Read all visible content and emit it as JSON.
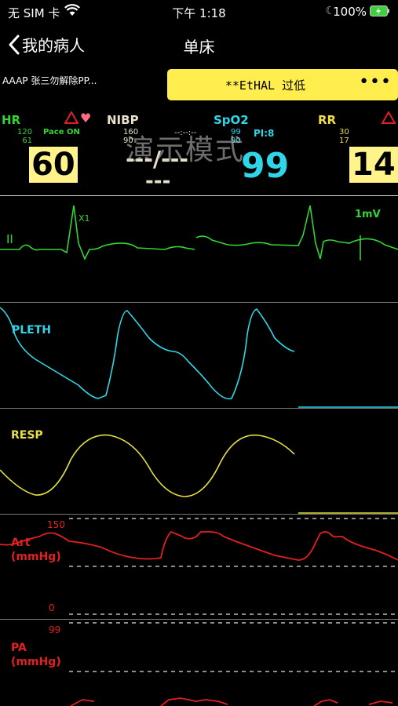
{
  "status_bar": {
    "carrier": "无 SIM 卡",
    "time": "下午 1:18",
    "battery": "100%"
  },
  "nav": {
    "back_label": "我的病人",
    "title": "单床"
  },
  "patient": {
    "info": "AAAP   张三勿解除PP..."
  },
  "alarm": {
    "message": "**EtHAL 过低",
    "more": "•••"
  },
  "watermark": "演示模式",
  "vitals": {
    "hr": {
      "label": "HR",
      "limit_high": "120",
      "limit_low": "61",
      "pace": "Pace ON",
      "value": "60",
      "color": "#35d435"
    },
    "nibp": {
      "label": "NIBP",
      "limit_high": "160",
      "limit_low": "90",
      "time": "--:--:--",
      "value_main": "---/---",
      "value_mean": "---",
      "color": "#e8e0c8"
    },
    "spo2": {
      "label": "SpO2",
      "limit_high": "99",
      "limit_low": "90",
      "pi": "PI:8",
      "value": "99",
      "color": "#2fd6e8"
    },
    "rr": {
      "label": "RR",
      "limit_high": "30",
      "limit_low": "17",
      "value": "14",
      "color": "#eedd44"
    }
  },
  "waveforms": {
    "ecg": {
      "lead": "II",
      "marker": "X1",
      "scale": "1mV",
      "color": "#35d435"
    },
    "pleth": {
      "label": "PLETH",
      "color": "#2fd6e8"
    },
    "resp": {
      "label": "RESP",
      "color": "#e6e040"
    },
    "art": {
      "label": "Art",
      "unit": "(mmHg)",
      "scale_top": "150",
      "scale_bottom": "0",
      "color": "#e22020"
    },
    "pa": {
      "label": "PA",
      "unit": "(mmHg)",
      "scale_top": "99",
      "color": "#e22020"
    }
  }
}
